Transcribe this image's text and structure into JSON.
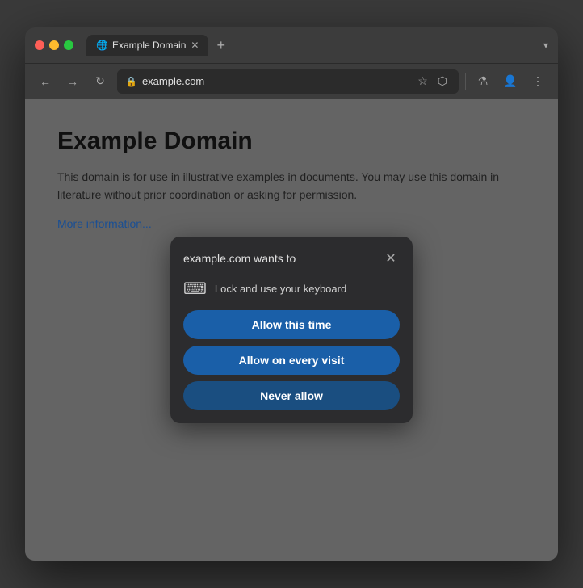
{
  "window": {
    "title": "Example Domain",
    "tab_close": "✕",
    "new_tab": "+",
    "tab_chevron": "▾"
  },
  "nav": {
    "back": "←",
    "forward": "→",
    "reload": "↻",
    "address": "example.com",
    "address_icon": "🔒",
    "bookmark": "☆",
    "extensions": "⬡",
    "flask": "⚗",
    "account": "👤",
    "menu": "⋮"
  },
  "page": {
    "heading": "Example Domain",
    "body": "This domain is for use in illustrative examples in documents. You may use this domain in literature without prior coordination or asking for permission.",
    "link": "More information..."
  },
  "dialog": {
    "title": "example.com wants to",
    "close_btn": "✕",
    "permission_icon": "⌨",
    "permission_text": "Lock and use your keyboard",
    "btn_allow_once": "Allow this time",
    "btn_allow_always": "Allow on every visit",
    "btn_never": "Never allow"
  },
  "colors": {
    "tl_red": "#ff5f57",
    "tl_yellow": "#febc2e",
    "tl_green": "#28c840",
    "btn_primary": "#1a5fa8",
    "btn_secondary": "#1a4e80"
  }
}
